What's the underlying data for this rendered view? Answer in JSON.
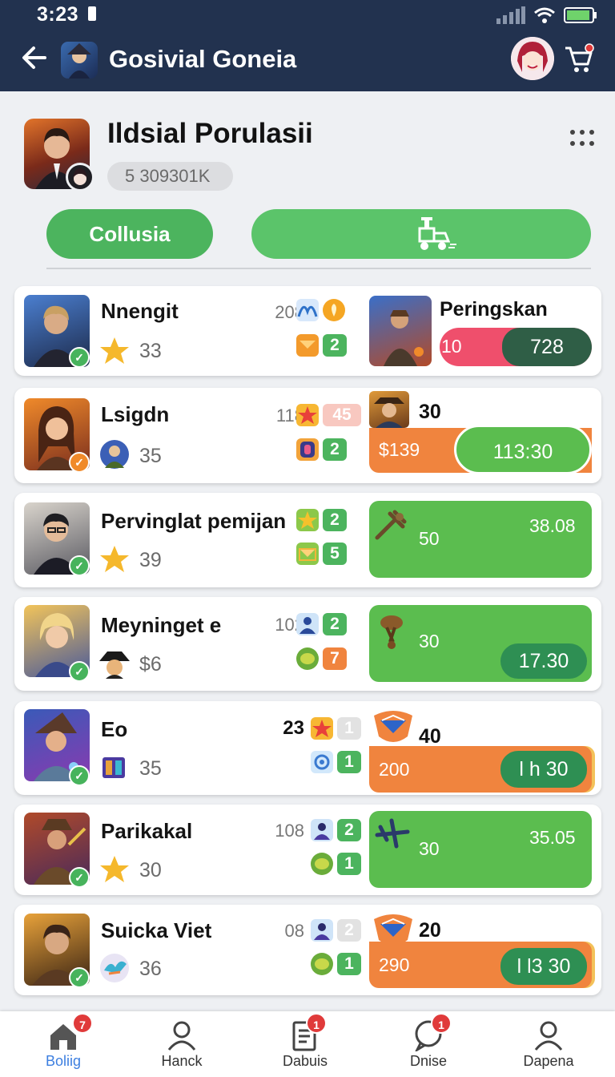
{
  "status_bar": {
    "time": "3:23"
  },
  "header": {
    "title": "Gosivial Goneia"
  },
  "profile": {
    "name": "Ildsial Porulasii",
    "count": "5 309301K",
    "primary_button": "Collusia"
  },
  "rows": [
    {
      "name": "Nnengit",
      "sub": "33",
      "stat": "208",
      "box1": "2",
      "panel": {
        "style": "split",
        "title": "Peringskan",
        "left": "10",
        "right": "728"
      }
    },
    {
      "name": "Lsigdn",
      "sub": "35",
      "stat": "118",
      "top_box": "45",
      "box1": "2",
      "panel": {
        "style": "orange",
        "title": "30",
        "left": "$139",
        "right": "113:30"
      }
    },
    {
      "name": "Pervinglat pemijan",
      "sub": "39",
      "stat": "",
      "box1": "2",
      "box2": "5",
      "panel": {
        "style": "green",
        "left": "50",
        "right": "38.08"
      }
    },
    {
      "name": "Meyninget e",
      "sub": "$6",
      "stat": "102",
      "box1": "2",
      "box2": "7",
      "panel": {
        "style": "green-pill",
        "left": "30",
        "right": "17.30"
      }
    },
    {
      "name": "Eo",
      "sub": "35",
      "stat": "23",
      "top_box": "1",
      "box1": "1",
      "panel": {
        "style": "orange",
        "title": "40",
        "left": "200",
        "right": "l h 30"
      }
    },
    {
      "name": "Parikakal",
      "sub": "30",
      "stat": "108",
      "box1": "2",
      "box2": "1",
      "panel": {
        "style": "green",
        "left": "30",
        "right": "35.05"
      }
    },
    {
      "name": "Suicka Viet",
      "sub": "36",
      "stat": "08",
      "top_box": "2",
      "box1": "1",
      "panel": {
        "style": "orange",
        "title": "20",
        "left": "290",
        "right": "l l3 30"
      }
    }
  ],
  "bottom_nav": [
    {
      "label": "Boliig",
      "badge": "7"
    },
    {
      "label": "Hanck"
    },
    {
      "label": "Dabuis",
      "badge": "1"
    },
    {
      "label": "Dnise",
      "badge": "1"
    },
    {
      "label": "Dapena"
    }
  ],
  "colors": {
    "header_bg": "#22324f",
    "accent_green": "#4cb45e",
    "dark_green": "#2e8f53",
    "orange": "#f0843e",
    "pink": "#ef4f6c",
    "nav_active": "#3d7fe0"
  }
}
